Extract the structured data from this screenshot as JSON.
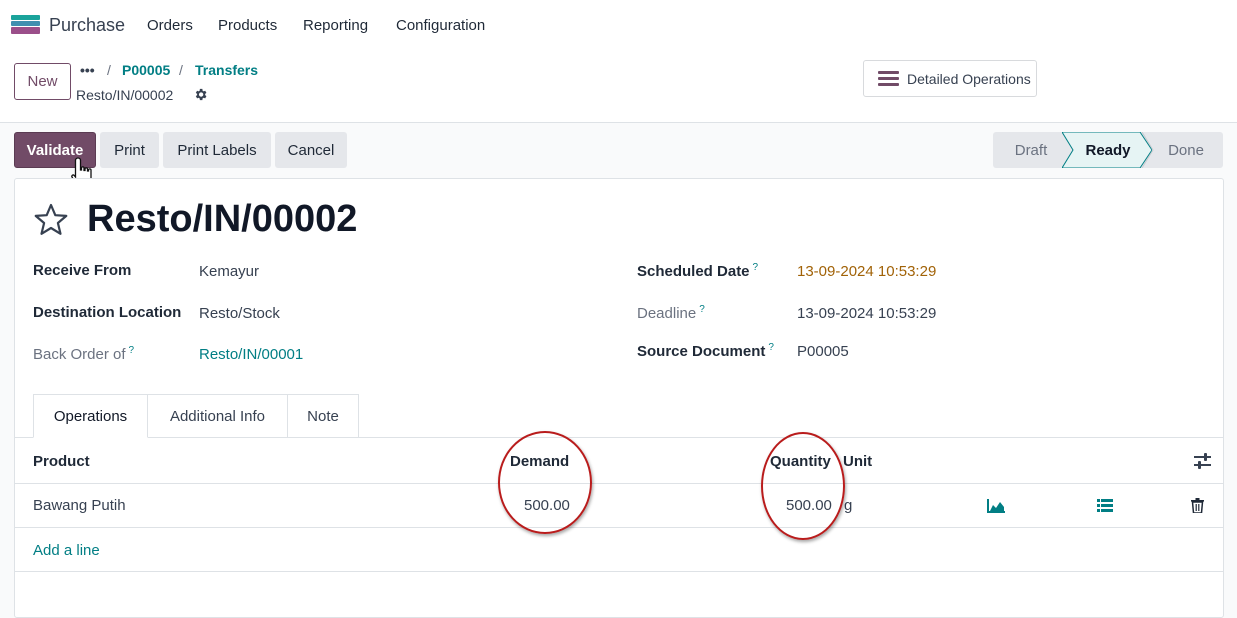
{
  "navbar": {
    "app_name": "Purchase",
    "menu": [
      "Orders",
      "Products",
      "Reporting",
      "Configuration"
    ]
  },
  "control_panel": {
    "new_label": "New",
    "breadcrumb_dots": "•••",
    "breadcrumbs": [
      "P00005",
      "Transfers"
    ],
    "separator": "/",
    "record_name": "Resto/IN/00002",
    "detailed_operations_label": "Detailed Operations"
  },
  "actions": {
    "validate": "Validate",
    "print": "Print",
    "print_labels": "Print Labels",
    "cancel": "Cancel"
  },
  "status_bar": {
    "stages": [
      "Draft",
      "Ready",
      "Done"
    ],
    "current": "Ready"
  },
  "form": {
    "title": "Resto/IN/00002",
    "left_fields": [
      {
        "label": "Receive From",
        "value": "Kemayur",
        "help": ""
      },
      {
        "label": "Destination Location",
        "value": "Resto/Stock",
        "help": ""
      },
      {
        "label": "Back Order of",
        "value": "Resto/IN/00001",
        "help": "?"
      }
    ],
    "right_fields": [
      {
        "label": "Scheduled Date",
        "value": "13-09-2024 10:53:29",
        "help": "?"
      },
      {
        "label": "Deadline",
        "value": "13-09-2024 10:53:29",
        "help": "?"
      },
      {
        "label": "Source Document",
        "value": "P00005",
        "help": "?"
      }
    ]
  },
  "tabs": [
    "Operations",
    "Additional Info",
    "Note"
  ],
  "operations": {
    "columns": {
      "product": "Product",
      "demand": "Demand",
      "quantity": "Quantity",
      "unit": "Unit"
    },
    "rows": [
      {
        "product": "Bawang Putih",
        "demand": "500.00",
        "quantity": "500.00",
        "unit": "g"
      }
    ],
    "add_line": "Add a line"
  },
  "colors": {
    "primary": "#714b67",
    "link": "#017e84",
    "annotation": "#b91c1c"
  }
}
